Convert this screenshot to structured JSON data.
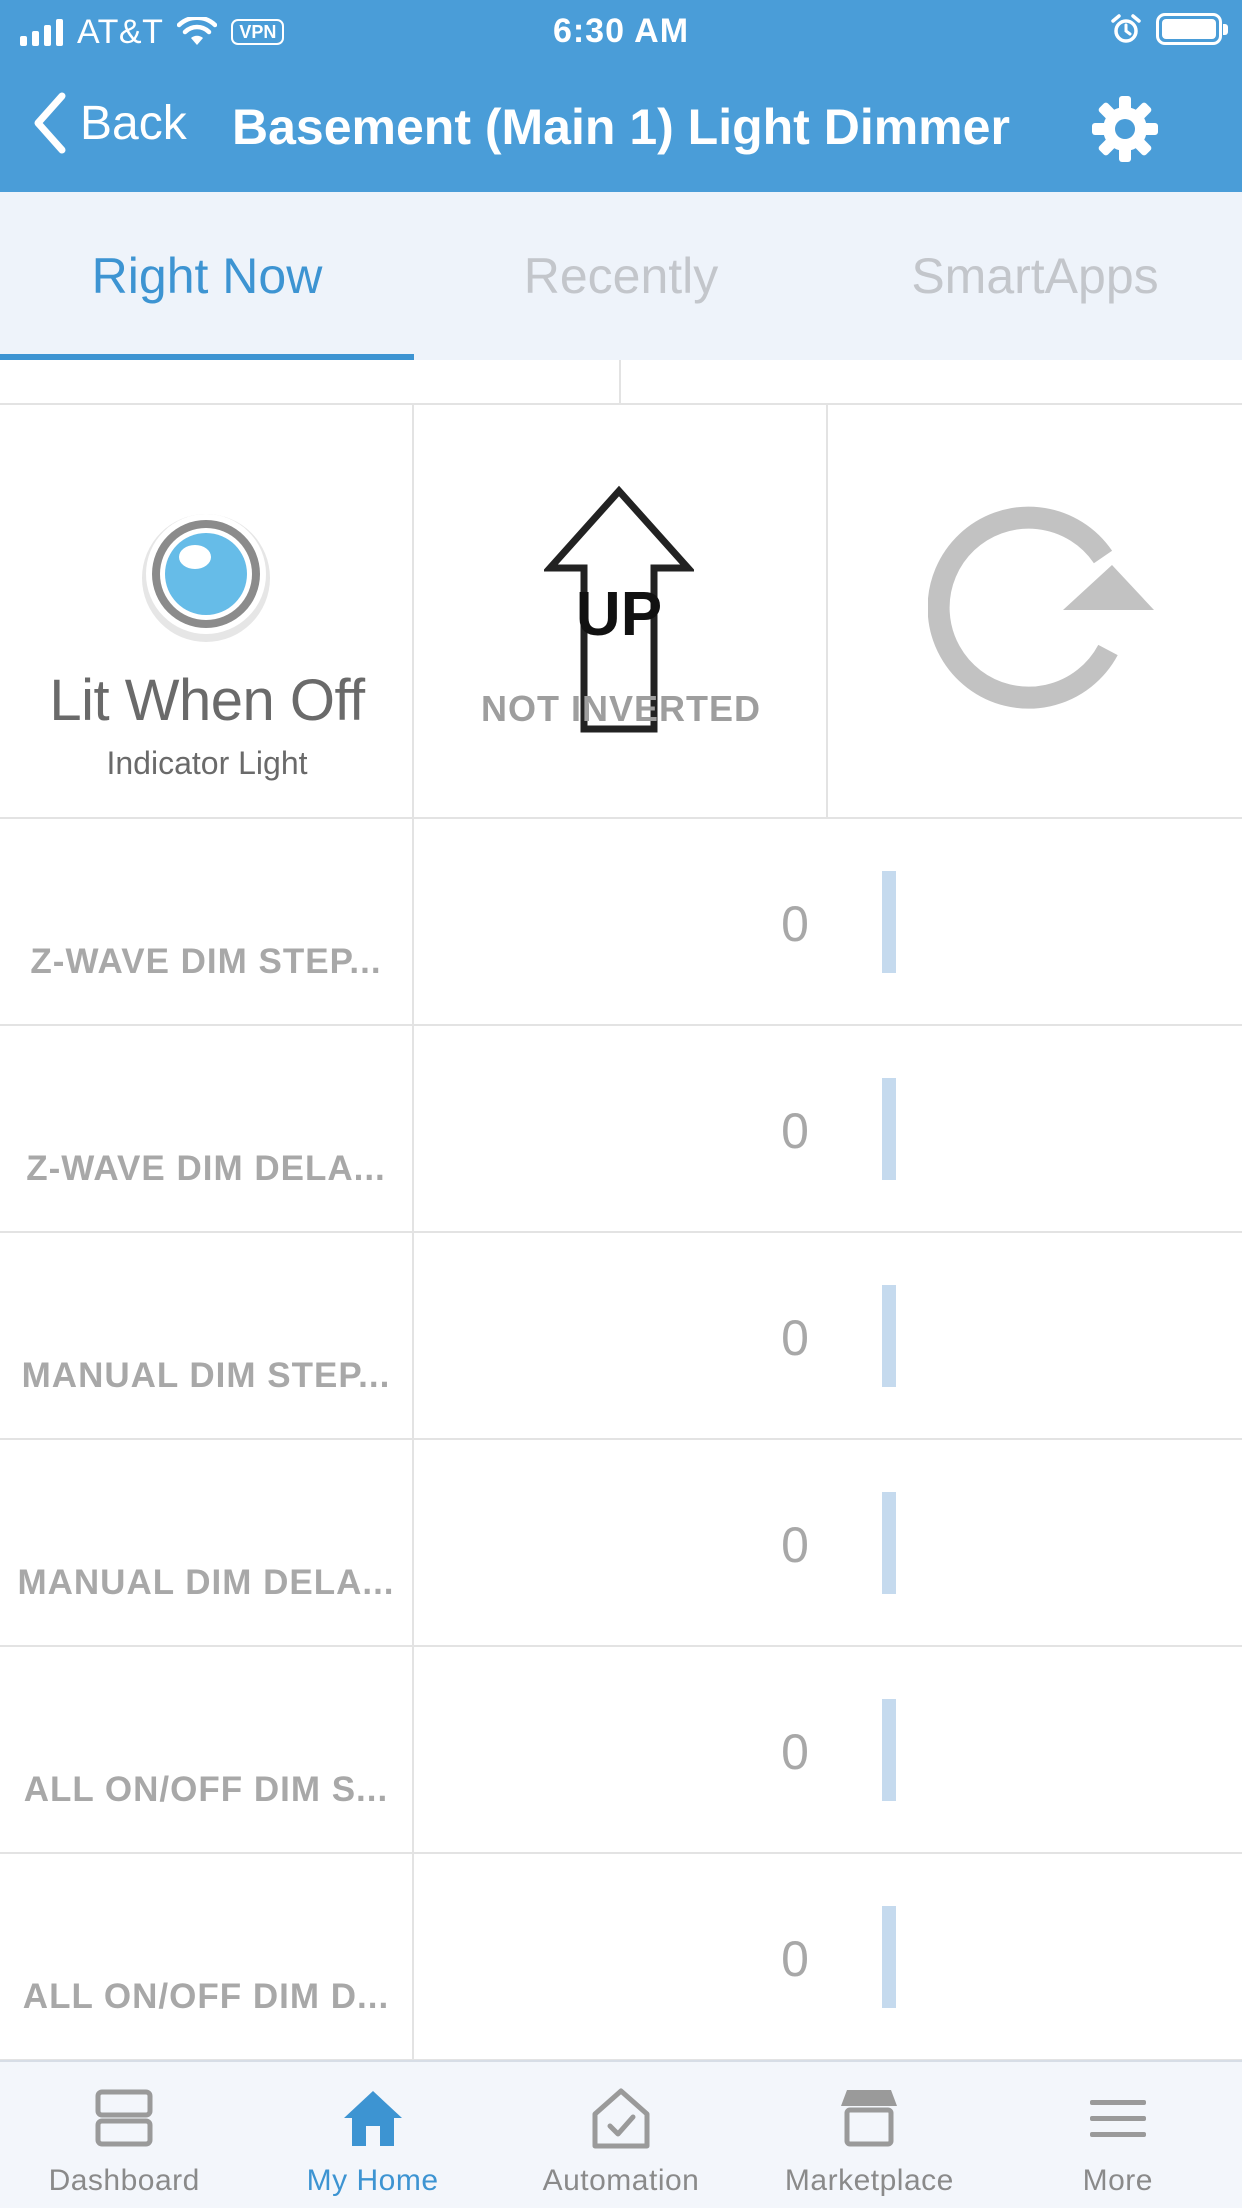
{
  "status_bar": {
    "carrier": "AT&T",
    "vpn_label": "VPN",
    "time": "6:30 AM",
    "icons": [
      "signal-icon",
      "wifi-icon",
      "alarm-icon",
      "battery-icon"
    ]
  },
  "nav": {
    "back_label": "Back",
    "title": "Basement (Main 1) Light Dimmer",
    "settings_icon": "gear-icon"
  },
  "tabs": [
    {
      "label": "Right Now",
      "active": true
    },
    {
      "label": "Recently",
      "active": false
    },
    {
      "label": "SmartApps",
      "active": false
    }
  ],
  "tiles": {
    "indicator": {
      "value": "Lit When Off",
      "label": "Indicator Light"
    },
    "orientation": {
      "icon_text": "UP",
      "status": "NOT INVERTED"
    },
    "refresh": {
      "icon": "refresh-icon"
    }
  },
  "parameters": [
    {
      "label": "Z-WAVE DIM STEP...",
      "value": "0"
    },
    {
      "label": "Z-WAVE DIM DELA...",
      "value": "0"
    },
    {
      "label": "MANUAL DIM STEP...",
      "value": "0"
    },
    {
      "label": "MANUAL DIM DELA...",
      "value": "0"
    },
    {
      "label": "ALL ON/OFF DIM S...",
      "value": "0"
    },
    {
      "label": "ALL ON/OFF DIM D...",
      "value": "0"
    }
  ],
  "bottom_nav": [
    {
      "label": "Dashboard",
      "icon": "dashboard-icon",
      "active": false
    },
    {
      "label": "My Home",
      "icon": "home-icon",
      "active": true
    },
    {
      "label": "Automation",
      "icon": "automation-icon",
      "active": false
    },
    {
      "label": "Marketplace",
      "icon": "marketplace-icon",
      "active": false
    },
    {
      "label": "More",
      "icon": "menu-icon",
      "active": false
    }
  ],
  "colors": {
    "header": "#4a9dd8",
    "accent": "#3d94d2",
    "tab_bg": "#eef3fa",
    "inactive_text": "#c3c6cb",
    "slider_bar": "#c5daee"
  }
}
